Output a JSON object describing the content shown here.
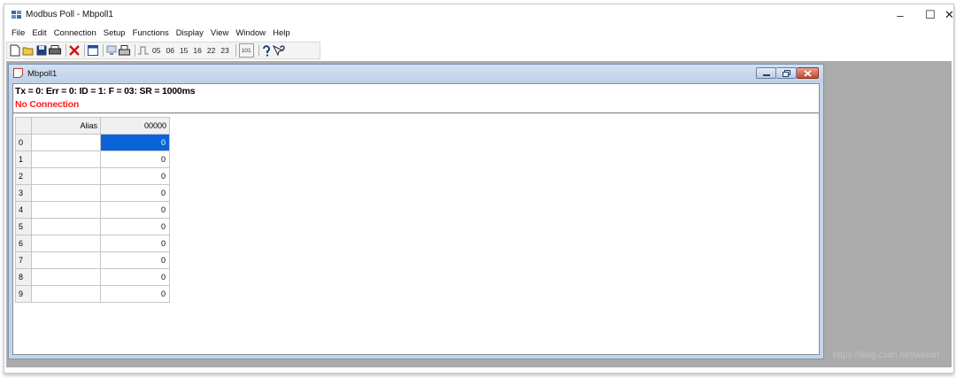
{
  "window": {
    "title": "Modbus Poll - Mbpoll1",
    "min_symbol": "–",
    "max_symbol": "☐",
    "close_symbol": "✕"
  },
  "menubar": [
    "File",
    "Edit",
    "Connection",
    "Setup",
    "Functions",
    "Display",
    "View",
    "Window",
    "Help"
  ],
  "toolbar": {
    "function_codes": [
      "05",
      "06",
      "15",
      "16",
      "22",
      "23"
    ],
    "counter_label": "101"
  },
  "child_window": {
    "title": "Mbpoll1",
    "status": "Tx = 0: Err = 0: ID = 1: F = 03: SR = 1000ms",
    "connection": "No Connection",
    "columns": {
      "alias": "Alias",
      "register": "00000"
    },
    "rows": [
      {
        "index": "0",
        "alias": "",
        "value": "0"
      },
      {
        "index": "1",
        "alias": "",
        "value": "0"
      },
      {
        "index": "2",
        "alias": "",
        "value": "0"
      },
      {
        "index": "3",
        "alias": "",
        "value": "0"
      },
      {
        "index": "4",
        "alias": "",
        "value": "0"
      },
      {
        "index": "5",
        "alias": "",
        "value": "0"
      },
      {
        "index": "6",
        "alias": "",
        "value": "0"
      },
      {
        "index": "7",
        "alias": "",
        "value": "0"
      },
      {
        "index": "8",
        "alias": "",
        "value": "0"
      },
      {
        "index": "9",
        "alias": "",
        "value": "0"
      }
    ]
  },
  "colors": {
    "no_connection": "#ff1a1a",
    "selection": "#0a64d8",
    "mdi_background": "#ababab"
  },
  "watermark": "https://blog.csdn.net/weixin"
}
